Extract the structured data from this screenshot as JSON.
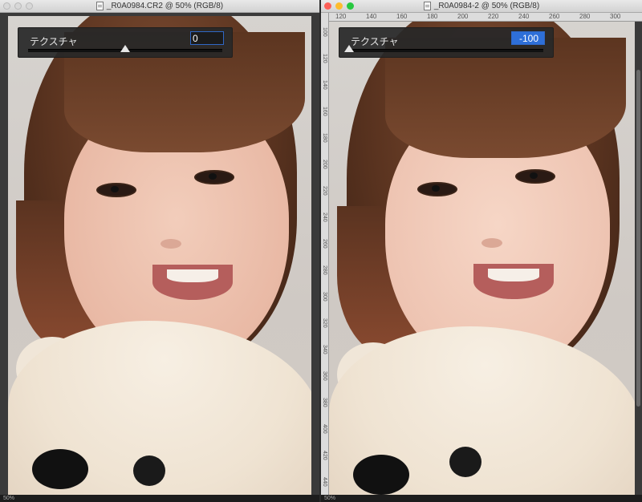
{
  "windows": [
    {
      "title": "_R0A0984.CR2 @ 50% (RGB/8)",
      "panel": {
        "label": "テクスチャ",
        "value": "0",
        "slider_level": 0.5
      },
      "footer": "50%"
    },
    {
      "title": "_R0A0984-2 @ 50% (RGB/8)",
      "panel": {
        "label": "テクスチャ",
        "value": "-100",
        "slider_level": 0.0
      },
      "footer": "50%",
      "ruler_top": [
        "120",
        "140",
        "160",
        "180",
        "200",
        "220",
        "240",
        "260",
        "280",
        "300"
      ],
      "ruler_left": [
        "100",
        "120",
        "140",
        "160",
        "180",
        "200",
        "220",
        "240",
        "260",
        "280",
        "300",
        "320",
        "340",
        "360",
        "380",
        "400",
        "420",
        "440"
      ]
    }
  ],
  "colors": {
    "field_border": "#2f67c5",
    "selected_value": "#2e6fd8",
    "panel_bg": "#282828"
  },
  "icons": [
    "close-icon",
    "minimize-icon",
    "zoom-icon",
    "document-icon"
  ]
}
